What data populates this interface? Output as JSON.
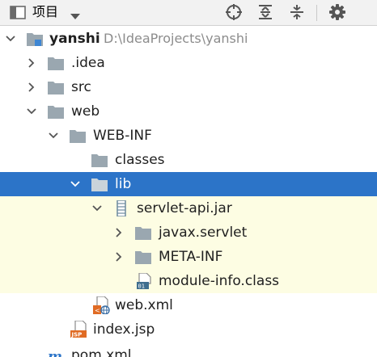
{
  "toolbar": {
    "view_label": "项目",
    "icons": {
      "view": "project-view-icon",
      "dropdown": "chevron-down-icon",
      "locate": "locate-crosshair-icon",
      "expand": "expand-all-icon",
      "collapse": "collapse-all-icon",
      "settings": "gear-icon"
    }
  },
  "tree": {
    "rows": [
      {
        "label": "yanshi",
        "hint": "D:\\IdeaProjects\\yanshi",
        "icon": "module-folder-icon",
        "expanded": true
      },
      {
        "label": ".idea",
        "icon": "folder-icon",
        "expanded": false
      },
      {
        "label": "src",
        "icon": "folder-icon",
        "expanded": false
      },
      {
        "label": "web",
        "icon": "folder-icon",
        "expanded": true
      },
      {
        "label": "WEB-INF",
        "icon": "folder-icon",
        "expanded": true
      },
      {
        "label": "classes",
        "icon": "folder-icon"
      },
      {
        "label": "lib",
        "icon": "folder-icon",
        "expanded": true,
        "selected": true
      },
      {
        "label": "servlet-api.jar",
        "icon": "jar-icon",
        "expanded": true
      },
      {
        "label": "javax.servlet",
        "icon": "folder-icon",
        "expanded": false
      },
      {
        "label": "META-INF",
        "icon": "folder-icon",
        "expanded": false
      },
      {
        "label": "module-info.class",
        "icon": "class-file-icon"
      },
      {
        "label": "web.xml",
        "icon": "web-xml-icon"
      },
      {
        "label": "index.jsp",
        "icon": "jsp-icon"
      },
      {
        "label": "pom.xml",
        "icon": "maven-pom-icon"
      }
    ]
  },
  "colors": {
    "selection": "#2c74c8",
    "library_highlight": "#fdfde3",
    "folder": "#9aa7b0",
    "toolbar_bg": "#f2f2f2"
  }
}
